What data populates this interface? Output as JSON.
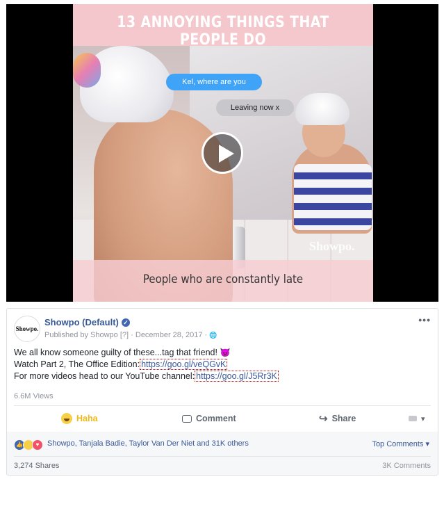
{
  "video": {
    "title_overlay": "13 ANNOYING THINGS THAT PEOPLE DO",
    "bubble_sent": "Kel, where are you",
    "bubble_received": "Leaving now x",
    "caption": "People who are constantly late",
    "watermark": "Showpo."
  },
  "post": {
    "avatar_text": "Showpo.",
    "page_name": "Showpo (Default)",
    "verified_glyph": "✓",
    "published_by": "Published by Showpo",
    "published_help": "[?]",
    "date": "December 28, 2017",
    "privacy_glyph": "🌐",
    "more_glyph": "•••",
    "line1": "We all know someone guilty of these...tag that friend!",
    "line1_emoji": "👿",
    "line2_prefix": "Watch Part 2, The Office Edition:",
    "line2_link": "https://goo.gl/veQGvK",
    "line3_prefix": "For more videos head to our YouTube channel:",
    "line3_link": "https://goo.gl/J5Rr3K",
    "views": "6.6M Views"
  },
  "actions": {
    "haha": "Haha",
    "comment": "Comment",
    "share": "Share",
    "share_glyph": "↪",
    "options_glyph": "▾"
  },
  "reactions": {
    "names": "Showpo, Tanjala Badie, Taylor Van Der Niet and 31K others",
    "top_comments": "Top Comments ▾",
    "shares": "3,274 Shares",
    "comments": "3K Comments"
  },
  "colors": {
    "link": "#385898",
    "haha": "#f0ba15",
    "title_band": "#f6c8cd"
  }
}
